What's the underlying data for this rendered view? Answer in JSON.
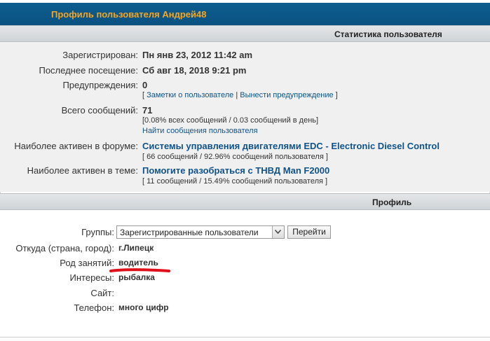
{
  "header": {
    "title": "Профиль пользователя Андрей48"
  },
  "stats": {
    "section_title": "Статистика пользователя",
    "registered": {
      "label": "Зарегистрирован:",
      "value": "Пн янв 23, 2012 11:42 am"
    },
    "last_visit": {
      "label": "Последнее посещение:",
      "value": "Сб авг 18, 2018 9:21 pm"
    },
    "warnings": {
      "label": "Предупреждения:",
      "value": "0",
      "bracket_open": "[",
      "notes_link": "Заметки о пользователе",
      "separator": "|",
      "warn_link": "Вынести предупреждение",
      "bracket_close": "]"
    },
    "posts": {
      "label": "Всего сообщений:",
      "value": "71",
      "detail": "[0.08% всех сообщений / 0.03 сообщений в день]",
      "find_link": "Найти сообщения пользователя"
    },
    "active_forum": {
      "label": "Наиболее активен в форуме:",
      "value": "Системы управления двигателями EDC - Electronic Diesel Control",
      "detail": "[ 66 сообщений / 92.96% сообщений пользователя ]"
    },
    "active_topic": {
      "label": "Наиболее активен в теме:",
      "value": "Помогите разобраться с ТНВД Man F2000",
      "detail": "[ 11 сообщений / 15.49% сообщений пользователя ]"
    }
  },
  "profile": {
    "section_title": "Профиль",
    "groups": {
      "label": "Группы:",
      "selected": "Зарегистрированные пользователи",
      "go_button": "Перейти"
    },
    "location": {
      "label": "Откуда (страна, город):",
      "value": "г.Липецк"
    },
    "occupation": {
      "label": "Род занятий:",
      "value": "водитель"
    },
    "interests": {
      "label": "Интересы:",
      "value": "рыбалка"
    },
    "website": {
      "label": "Сайт:",
      "value": ""
    },
    "phone": {
      "label": "Телефон:",
      "value": "много цифр"
    }
  },
  "colors": {
    "header_bg": "#0a5282",
    "header_text": "#f5a623",
    "link": "#105289",
    "underline_annotation": "#e0101a"
  }
}
